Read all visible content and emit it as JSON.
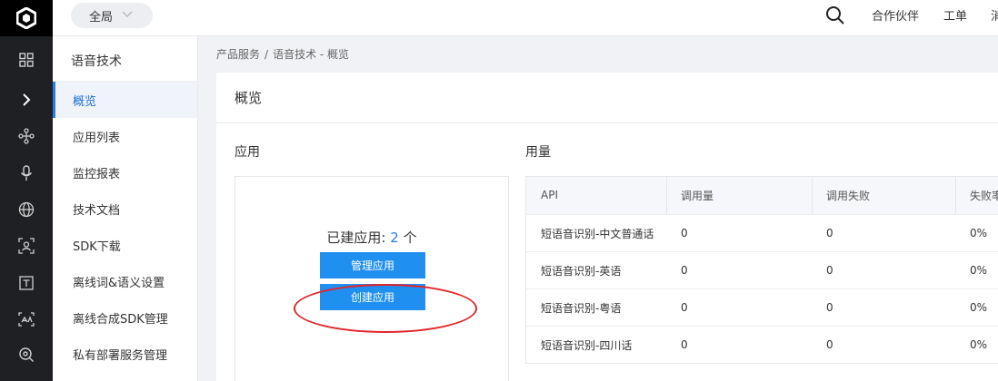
{
  "topbar": {
    "region": "全局",
    "links": [
      "合作伙伴",
      "工单",
      "消"
    ]
  },
  "rail": {
    "icons": [
      "logo-icon",
      "grid-icon",
      "chevron-right-icon",
      "nodes-icon",
      "microphone-icon",
      "globe-icon",
      "scan-face-icon",
      "text-t-icon",
      "image-text-icon",
      "search-eye-icon"
    ]
  },
  "sidebar": {
    "title": "语音技术",
    "items": [
      {
        "label": "概览",
        "active": true
      },
      {
        "label": "应用列表"
      },
      {
        "label": "监控报表"
      },
      {
        "label": "技术文档"
      },
      {
        "label": "SDK下载"
      },
      {
        "label": "离线词&语义设置"
      },
      {
        "label": "离线合成SDK管理"
      },
      {
        "label": "私有部署服务管理"
      }
    ]
  },
  "breadcrumb": {
    "items": [
      "产品服务",
      "语音技术 - 概览"
    ],
    "separator": "/"
  },
  "main": {
    "title": "概览",
    "apps": {
      "section_title": "应用",
      "count_prefix": "已建应用: ",
      "count": "2",
      "count_suffix": " 个",
      "manage_button": "管理应用",
      "create_button": "创建应用"
    },
    "usage": {
      "section_title": "用量",
      "columns": [
        "API",
        "调用量",
        "调用失败",
        "失败率"
      ],
      "rows": [
        [
          "短语音识别-中文普通话",
          "0",
          "0",
          "0%"
        ],
        [
          "短语音识别-英语",
          "0",
          "0",
          "0%"
        ],
        [
          "短语音识别-粤语",
          "0",
          "0",
          "0%"
        ],
        [
          "短语音识别-四川话",
          "0",
          "0",
          "0%"
        ]
      ]
    }
  },
  "colors": {
    "accent": "#1f8ff0",
    "rail": "#1f2024",
    "annotation": "#e0262b"
  }
}
